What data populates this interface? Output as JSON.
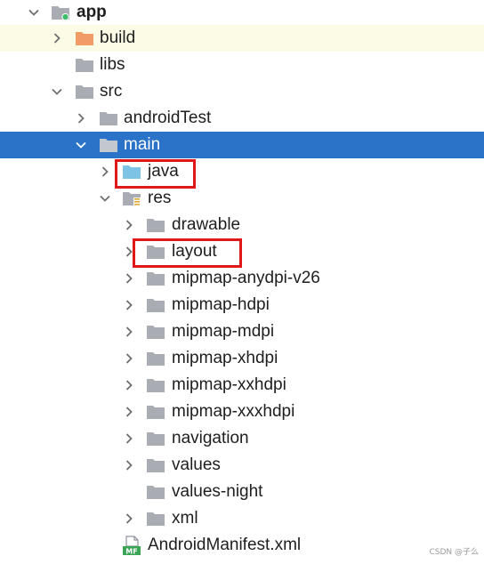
{
  "tree": {
    "app": "app",
    "build": "build",
    "libs": "libs",
    "src": "src",
    "androidTest": "androidTest",
    "main": "main",
    "java": "java",
    "res": "res",
    "drawable": "drawable",
    "layout": "layout",
    "mipmap_anydpi_v26": "mipmap-anydpi-v26",
    "mipmap_hdpi": "mipmap-hdpi",
    "mipmap_mdpi": "mipmap-mdpi",
    "mipmap_xhdpi": "mipmap-xhdpi",
    "mipmap_xxhdpi": "mipmap-xxhdpi",
    "mipmap_xxxhdpi": "mipmap-xxxhdpi",
    "navigation": "navigation",
    "values": "values",
    "values_night": "values-night",
    "xml": "xml",
    "manifest": "AndroidManifest.xml",
    "manifest_badge": "MF"
  },
  "watermark": "CSDN @子么",
  "colors": {
    "selection": "#2a73c9",
    "hover_row": "#fcfbe6",
    "folder": "#a9adb3",
    "build_folder": "#f19b66",
    "java_folder": "#7cc3e6",
    "highlight_box": "#e01818",
    "module_dot": "#3dbd6b"
  }
}
